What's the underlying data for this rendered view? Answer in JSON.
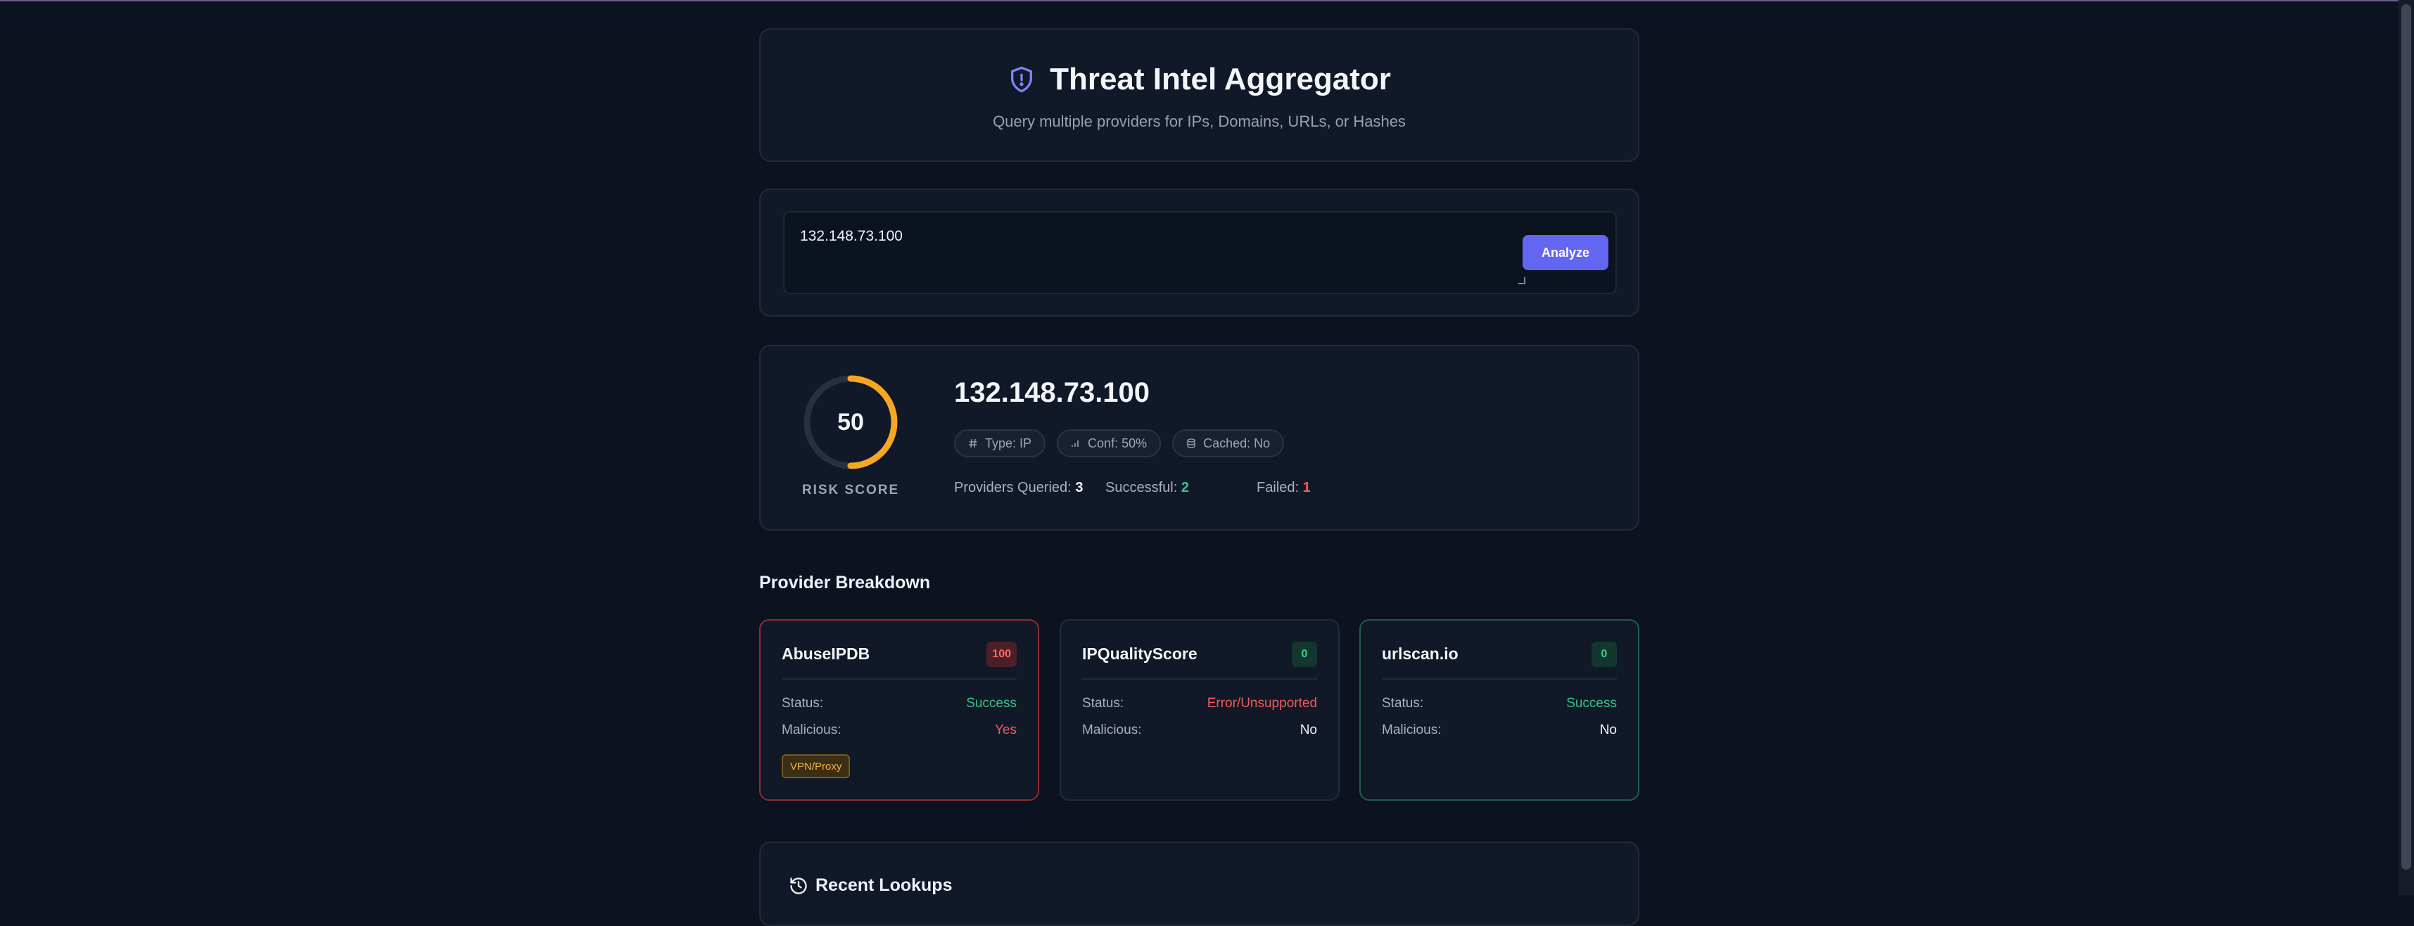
{
  "header": {
    "title": "Threat Intel Aggregator",
    "subtitle": "Query multiple providers for IPs, Domains, URLs, or Hashes",
    "icon": "shield-icon"
  },
  "search": {
    "value": "132.148.73.100",
    "button_label": "Analyze"
  },
  "result": {
    "risk_score": "50",
    "risk_score_fraction": 0.5,
    "risk_label": "RISK SCORE",
    "target": "132.148.73.100",
    "chips": {
      "type": "Type: IP",
      "confidence": "Conf: 50%",
      "cached": "Cached: No"
    },
    "stats": {
      "queried_label": "Providers Queried:",
      "queried_value": "3",
      "successful_label": "Successful:",
      "successful_value": "2",
      "failed_label": "Failed:",
      "failed_value": "1"
    }
  },
  "breakdown": {
    "title": "Provider Breakdown",
    "status_label": "Status:",
    "malicious_label": "Malicious:",
    "providers": [
      {
        "name": "AbuseIPDB",
        "score": "100",
        "status": "Success",
        "malicious": "Yes",
        "tag": "VPN/Proxy"
      },
      {
        "name": "IPQualityScore",
        "score": "0",
        "status": "Error/Unsupported",
        "malicious": "No"
      },
      {
        "name": "urlscan.io",
        "score": "0",
        "status": "Success",
        "malicious": "No"
      }
    ]
  },
  "recent": {
    "title": "Recent Lookups",
    "icon": "history-icon"
  },
  "colors": {
    "accent": "#6366f1",
    "success": "#34c58a",
    "danger": "#f25b5b",
    "warning": "#f5a623"
  }
}
